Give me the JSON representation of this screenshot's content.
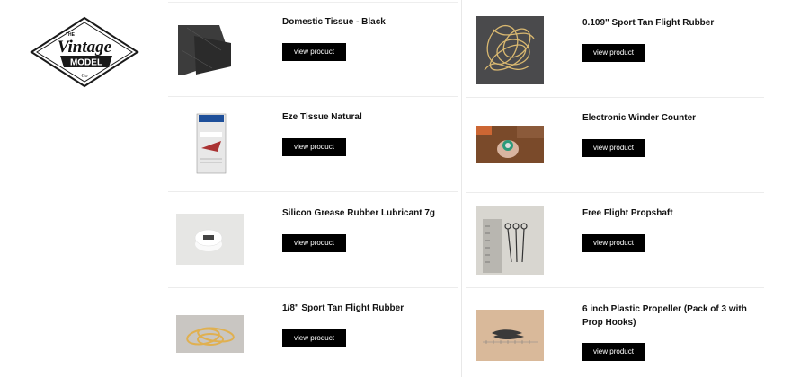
{
  "brand": {
    "logo_text_the": "THE",
    "logo_text_vintage": "Vintage",
    "logo_text_model": "MODEL",
    "logo_text_co": "Co"
  },
  "products": [
    {
      "title": "Domestic Tissue - Black",
      "button": "view product",
      "thumb": "black-tissue-image"
    },
    {
      "title": "0.109\" Sport Tan Flight Rubber",
      "button": "view product",
      "thumb": "rubber-bands-image"
    },
    {
      "title": "Eze Tissue Natural",
      "button": "view product",
      "thumb": "tissue-package-image"
    },
    {
      "title": "Electronic Winder Counter",
      "button": "view product",
      "thumb": "winder-counter-image"
    },
    {
      "title": "Silicon Grease Rubber Lubricant 7g",
      "button": "view product",
      "thumb": "grease-tub-image"
    },
    {
      "title": "Free Flight Propshaft",
      "button": "view product",
      "thumb": "propshaft-image"
    },
    {
      "title": "1/8\" Sport Tan Flight Rubber",
      "button": "view product",
      "thumb": "rubber-loop-image"
    },
    {
      "title": "6 inch Plastic Propeller (Pack of 3 with Prop Hooks)",
      "button": "view product",
      "thumb": "propeller-image"
    }
  ]
}
